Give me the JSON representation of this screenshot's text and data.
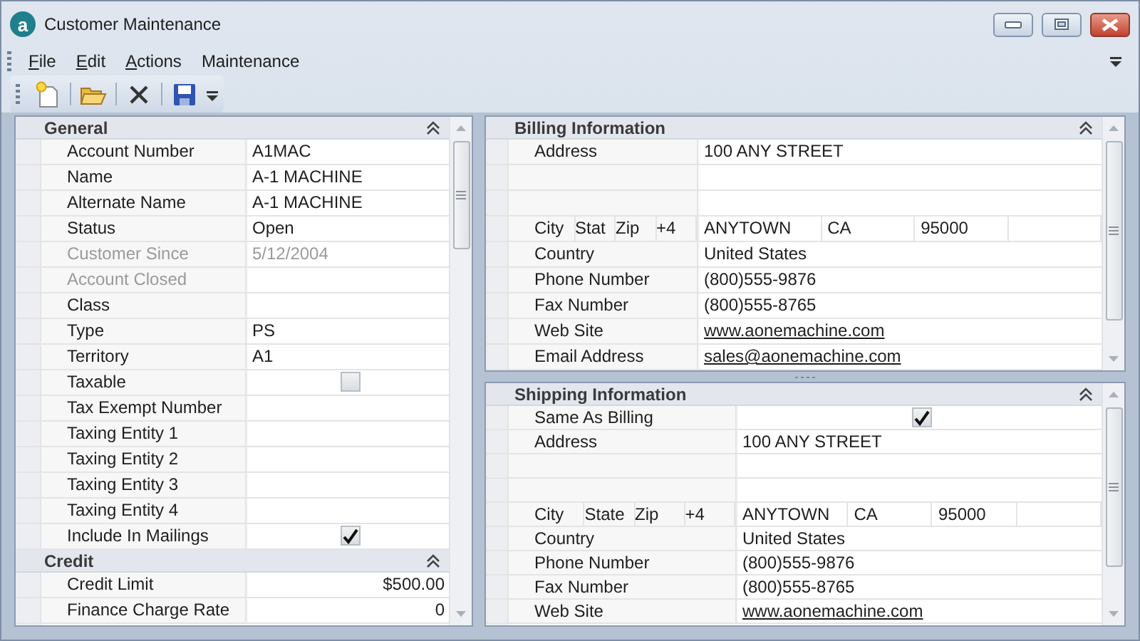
{
  "window": {
    "title": "Customer Maintenance",
    "app_icon_letter": "a"
  },
  "menu": [
    {
      "label": "File",
      "underlined": true
    },
    {
      "label": "Edit",
      "underlined": true
    },
    {
      "label": "Actions",
      "underlined": true
    },
    {
      "label": "Maintenance",
      "underlined": false
    }
  ],
  "toolbar": [
    {
      "kind": "new"
    },
    {
      "kind": "open"
    },
    {
      "kind": "delete"
    },
    {
      "kind": "save"
    }
  ],
  "left_panel": {
    "sections": [
      {
        "title": "General",
        "expanded": true,
        "rows": [
          {
            "kind": "text",
            "label": "Account Number",
            "value": "A1MAC",
            "disabled": false
          },
          {
            "kind": "text",
            "label": "Name",
            "value": "A-1 MACHINE",
            "disabled": false
          },
          {
            "kind": "text",
            "label": "Alternate Name",
            "value": "A-1 MACHINE",
            "disabled": false
          },
          {
            "kind": "text",
            "label": "Status",
            "value": "Open",
            "disabled": false
          },
          {
            "kind": "text",
            "label": "Customer Since",
            "value": "5/12/2004",
            "disabled": true
          },
          {
            "kind": "text",
            "label": "Account Closed",
            "disabled": true
          },
          {
            "kind": "text",
            "label": "Class",
            "disabled": false
          },
          {
            "kind": "text",
            "label": "Type",
            "value": "PS",
            "disabled": false
          },
          {
            "kind": "text",
            "label": "Territory",
            "value": "A1",
            "disabled": false
          },
          {
            "kind": "checkbox",
            "label": "Taxable",
            "checked": false,
            "disabled": false
          },
          {
            "kind": "text",
            "label": "Tax Exempt Number",
            "disabled": false
          },
          {
            "kind": "text",
            "label": "Taxing Entity 1",
            "disabled": false
          },
          {
            "kind": "text",
            "label": "Taxing Entity 2",
            "disabled": false
          },
          {
            "kind": "text",
            "label": "Taxing Entity 3",
            "disabled": false
          },
          {
            "kind": "text",
            "label": "Taxing Entity 4",
            "disabled": false
          },
          {
            "kind": "checkbox",
            "label": "Include In Mailings",
            "checked": true,
            "disabled": false
          }
        ]
      },
      {
        "title": "Credit",
        "expanded": true,
        "rows": [
          {
            "kind": "number",
            "label": "Credit Limit",
            "value": "$500.00",
            "disabled": false
          },
          {
            "kind": "number",
            "label": "Finance Charge Rate",
            "value": "0",
            "disabled": false
          }
        ]
      }
    ]
  },
  "billing": {
    "title": "Billing Information",
    "expanded": true,
    "rows": [
      {
        "kind": "text",
        "label": "Address",
        "value": "100 ANY STREET"
      },
      {
        "kind": "blank"
      },
      {
        "kind": "blank"
      },
      {
        "kind": "city",
        "labels": [
          "City",
          "Stat",
          "Zip",
          "+4"
        ],
        "values": [
          "ANYTOWN",
          "CA",
          "95000"
        ]
      },
      {
        "kind": "text",
        "label": "Country",
        "value": "United States"
      },
      {
        "kind": "text",
        "label": "Phone Number",
        "value": "(800)555-9876"
      },
      {
        "kind": "text",
        "label": "Fax Number",
        "value": "(800)555-8765"
      },
      {
        "kind": "link",
        "label": "Web Site",
        "value": "www.aonemachine.com"
      },
      {
        "kind": "link",
        "label": "Email Address",
        "value": "sales@aonemachine.com"
      }
    ]
  },
  "shipping": {
    "title": "Shipping Information",
    "expanded": true,
    "rows": [
      {
        "kind": "checkbox",
        "label": "Same As Billing",
        "checked": true
      },
      {
        "kind": "text",
        "label": "Address",
        "value": "100 ANY STREET"
      },
      {
        "kind": "blank"
      },
      {
        "kind": "blank"
      },
      {
        "kind": "city",
        "labels": [
          "City",
          "State",
          "Zip",
          "+4"
        ],
        "values": [
          "ANYTOWN",
          "CA",
          "95000"
        ]
      },
      {
        "kind": "text",
        "label": "Country",
        "value": "United States"
      },
      {
        "kind": "text",
        "label": "Phone Number",
        "value": "(800)555-9876"
      },
      {
        "kind": "text",
        "label": "Fax Number",
        "value": "(800)555-8765"
      },
      {
        "kind": "link",
        "label": "Web Site",
        "value": "www.aonemachine.com"
      }
    ]
  }
}
